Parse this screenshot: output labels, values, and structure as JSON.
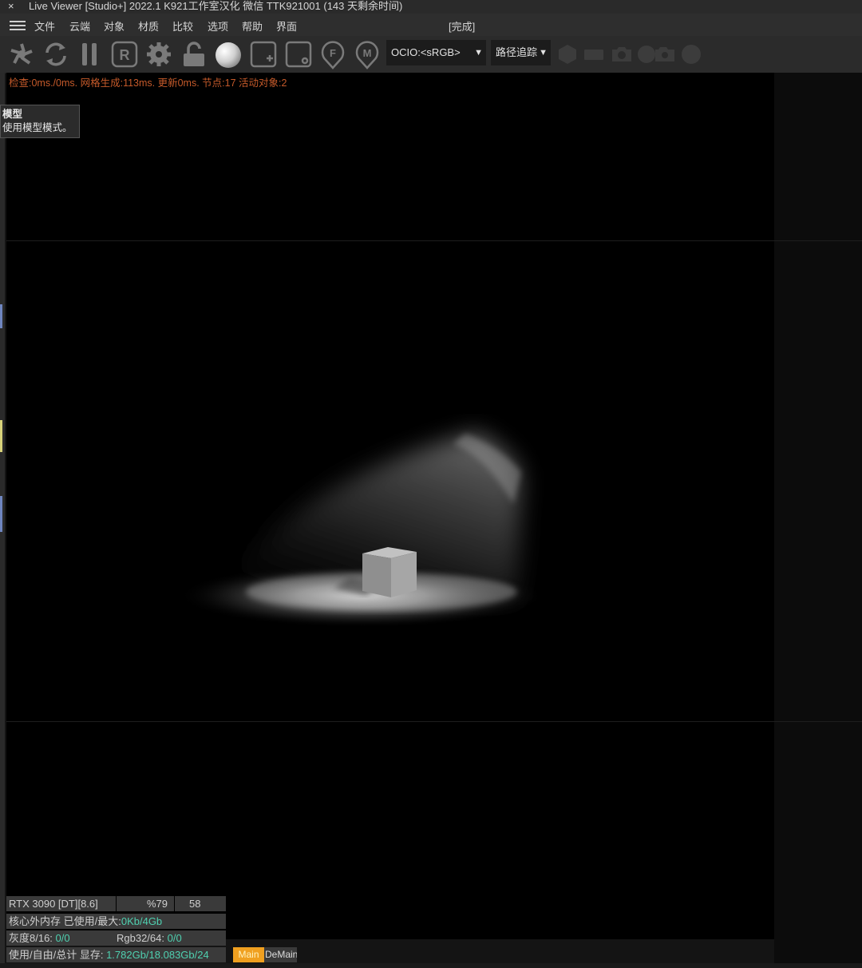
{
  "titlebar": {
    "close": "×",
    "title": "Live Viewer [Studio+] 2022.1  K921工作室汉化  微信  TTK921001 (143 天剩余时间)"
  },
  "menu": {
    "items": [
      "文件",
      "云端",
      "对象",
      "材质",
      "比较",
      "选项",
      "帮助",
      "界面"
    ],
    "status": "[完成]"
  },
  "toolbar": {
    "ocio_label": "OCIO:<sRGB>",
    "kernel_label": "路径追踪",
    "icons": [
      "render-icon",
      "refresh-icon",
      "pause-icon",
      "region-icon",
      "settings-icon",
      "lock-icon",
      "sphere-icon",
      "add-frame-icon",
      "object-frame-icon",
      "focus-icon",
      "material-icon"
    ]
  },
  "stats_line": "检查:0ms./0ms. 网格生成:113ms. 更新0ms. 节点:17 活动对象:2",
  "tooltip": {
    "title": "模型",
    "description": "使用模型模式。"
  },
  "info": {
    "gpu": "RTX 3090 [DT][8.6]",
    "gpu_percent": "%79",
    "gpu_temp": "58",
    "outofcore_label": "核心外内存 已使用/最大:",
    "outofcore_value": "0Kb/4Gb",
    "gray_label": "灰度8/16: ",
    "gray_value": "0/0",
    "rgb_label": "Rgb32/64: ",
    "rgb_value": "0/0",
    "vram_label": "使用/自由/总计 显存: ",
    "vram_value": "1.782Gb/18.083Gb/24"
  },
  "tabs": {
    "main": "Main",
    "demain": "DeMain"
  }
}
